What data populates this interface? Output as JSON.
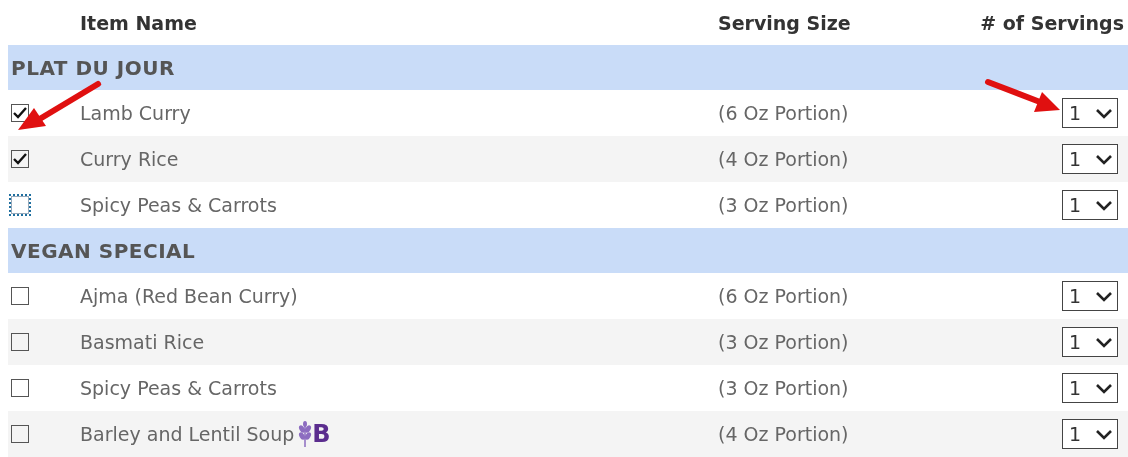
{
  "columns": [
    "Item Name",
    "Serving Size",
    "# of Servings"
  ],
  "groups": [
    {
      "title": "PLAT DU JOUR",
      "items": [
        {
          "name": "Lamb Curry",
          "serving": "(6 Oz Portion)",
          "count": "1",
          "checked": true,
          "focused": false
        },
        {
          "name": "Curry Rice",
          "serving": "(4 Oz Portion)",
          "count": "1",
          "checked": true,
          "focused": false
        },
        {
          "name": "Spicy Peas & Carrots",
          "serving": "(3 Oz Portion)",
          "count": "1",
          "checked": false,
          "focused": true
        }
      ]
    },
    {
      "title": "VEGAN SPECIAL",
      "items": [
        {
          "name": "Ajma (Red Bean Curry)",
          "serving": "(6 Oz Portion)",
          "count": "1",
          "checked": false,
          "focused": false
        },
        {
          "name": "Basmati Rice",
          "serving": "(3 Oz Portion)",
          "count": "1",
          "checked": false,
          "focused": false
        },
        {
          "name": "Spicy Peas & Carrots",
          "serving": "(3 Oz Portion)",
          "count": "1",
          "checked": false,
          "focused": false
        },
        {
          "name": "Barley and Lentil Soup",
          "serving": "(4 Oz Portion)",
          "count": "1",
          "checked": false,
          "focused": false,
          "badge": "B"
        }
      ]
    }
  ]
}
